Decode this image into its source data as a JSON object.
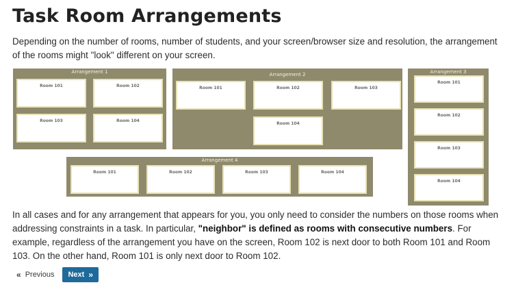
{
  "page": {
    "title": "Task Room Arrangements",
    "intro": "Depending on the number of rooms, number of students, and your screen/browser size and resolution, the arrangement of the rooms might \"look\" different on your screen.",
    "rules_part1": "In all cases and for any arrangement that appears for you, you only need to consider the numbers on those rooms when addressing constraints in a task. In particular, ",
    "rules_bold": "\"neighbor\" is defined as rooms with consecutive numbers",
    "rules_part2": ". For example, regardless of the arrangement you have on the screen, Room 102 is next door to both Room 101 and Room 103. On the other hand, Room 101 is only next door to Room 102."
  },
  "arrangements": {
    "a1": {
      "label": "Arrangement 1",
      "rooms": [
        "Room 101",
        "Room 102",
        "Room 103",
        "Room 104"
      ]
    },
    "a2": {
      "label": "Arrangement 2",
      "rooms": [
        "Room 101",
        "Room 102",
        "Room 103",
        "Room 104"
      ]
    },
    "a3": {
      "label": "Arrangement 3",
      "rooms": [
        "Room 101",
        "Room 102",
        "Room 103",
        "Room 104"
      ]
    },
    "a4": {
      "label": "Arrangement 4",
      "rooms": [
        "Room 101",
        "Room 102",
        "Room 103",
        "Room 104"
      ]
    }
  },
  "nav": {
    "previous_label": "Previous",
    "next_label": "Next",
    "prev_icon": "«",
    "next_icon": "»"
  },
  "colors": {
    "panel": "#8f8a6c",
    "room_border": "#e8e2b5",
    "next_button": "#1e6a9a"
  }
}
